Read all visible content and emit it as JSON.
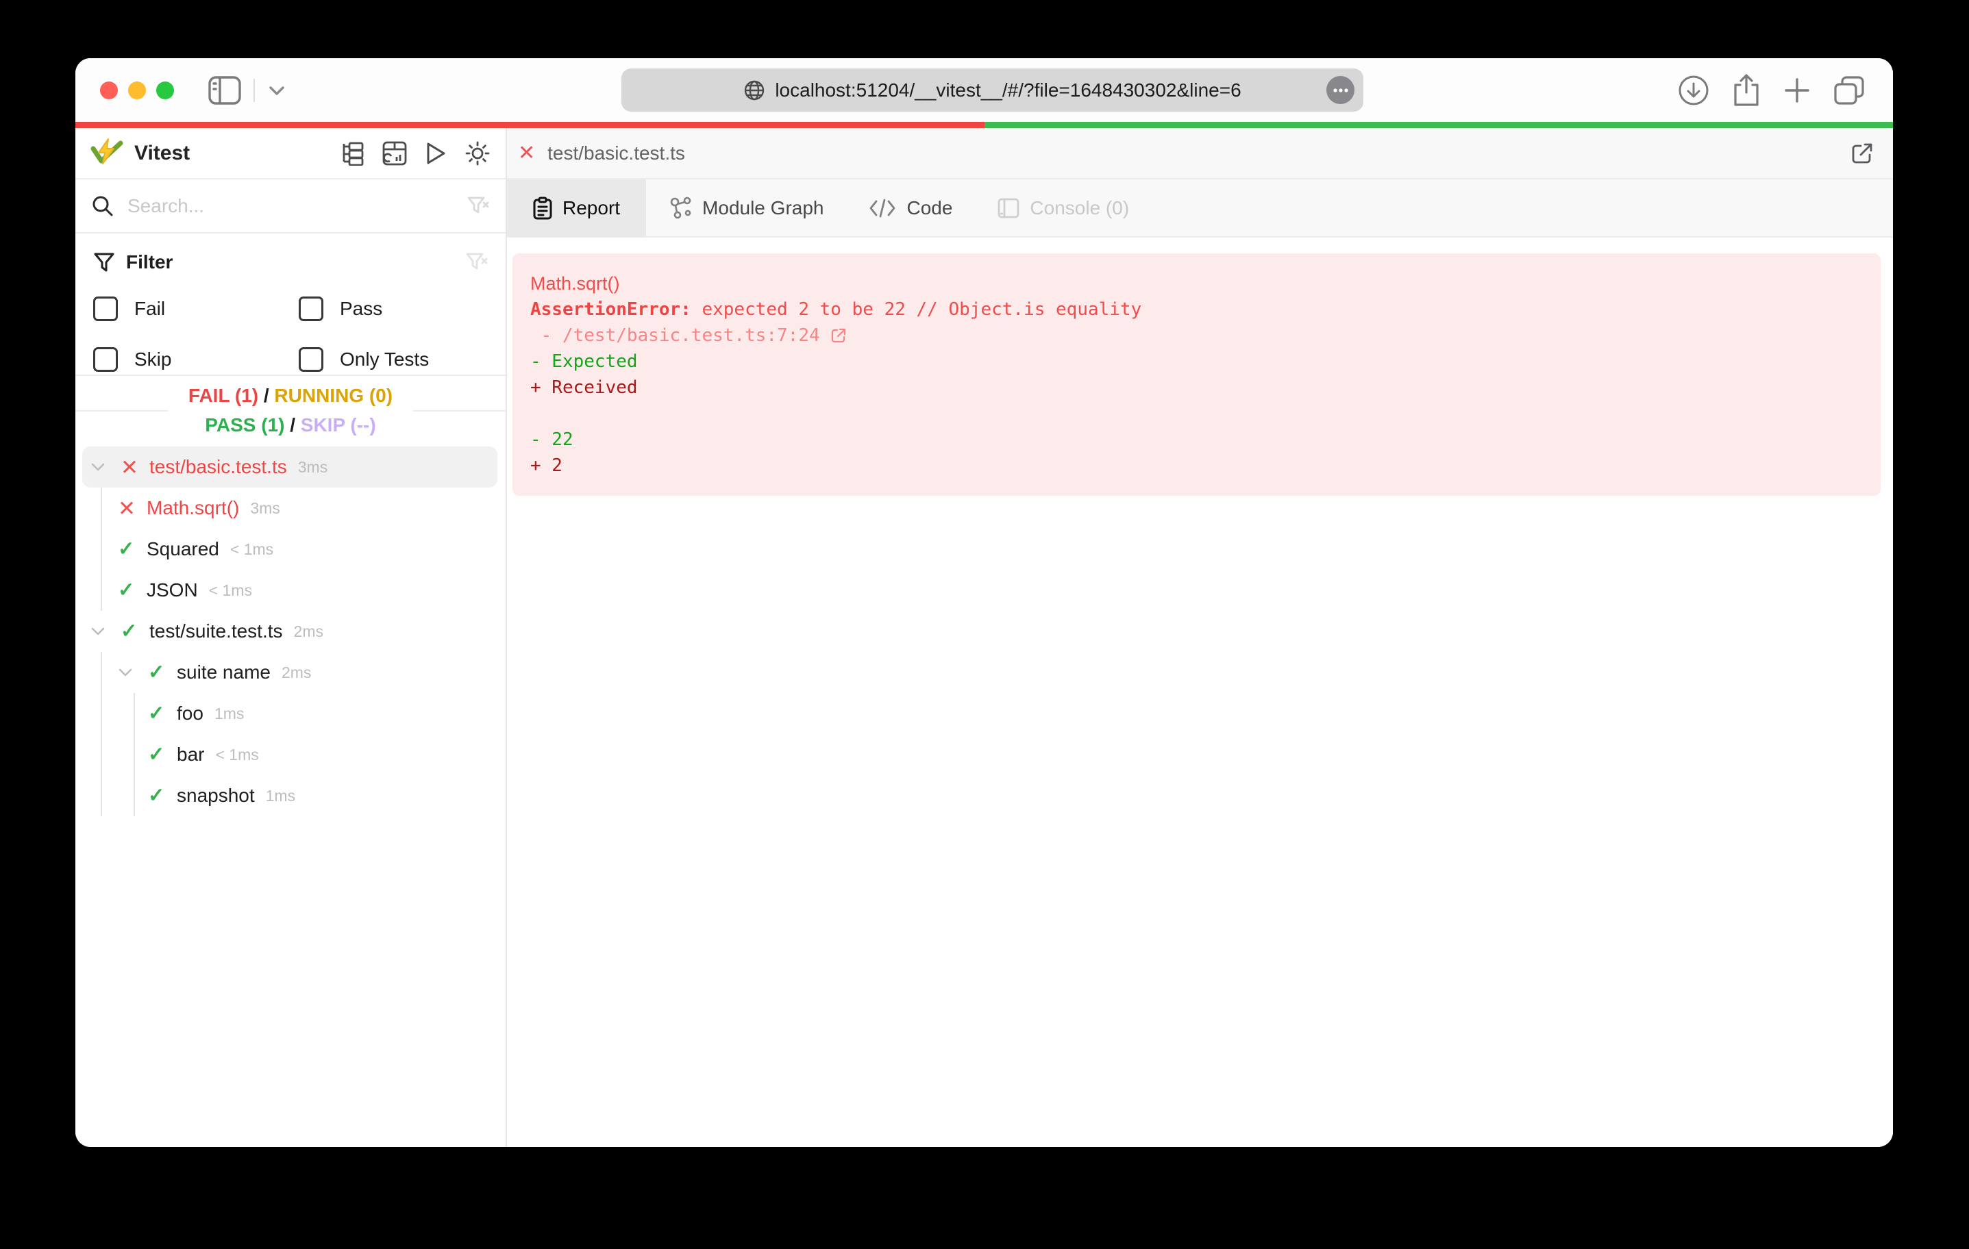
{
  "browser": {
    "url": "localhost:51204/__vitest__/#/?file=1648430302&line=6"
  },
  "progress": {
    "fail_percent": 50,
    "pass_percent": 50
  },
  "sidebar": {
    "title": "Vitest",
    "search_placeholder": "Search...",
    "filter": {
      "title": "Filter",
      "options": [
        {
          "label": "Fail",
          "checked": false
        },
        {
          "label": "Pass",
          "checked": false
        },
        {
          "label": "Skip",
          "checked": false
        },
        {
          "label": "Only Tests",
          "checked": false
        }
      ]
    },
    "summary": {
      "fail": "FAIL (1)",
      "running": "RUNNING (0)",
      "pass": "PASS (1)",
      "skip": "SKIP (--)",
      "separator": "/"
    },
    "tree": [
      {
        "label": "test/basic.test.ts",
        "duration": "3ms",
        "state": "fail",
        "level": 0,
        "expanded": true,
        "selected": true
      },
      {
        "label": "Math.sqrt()",
        "duration": "3ms",
        "state": "fail",
        "level": 1
      },
      {
        "label": "Squared",
        "duration": "< 1ms",
        "state": "pass",
        "level": 1
      },
      {
        "label": "JSON",
        "duration": "< 1ms",
        "state": "pass",
        "level": 1
      },
      {
        "label": "test/suite.test.ts",
        "duration": "2ms",
        "state": "pass",
        "level": 0,
        "expanded": true
      },
      {
        "label": "suite name",
        "duration": "2ms",
        "state": "pass",
        "level": 1,
        "expanded": true
      },
      {
        "label": "foo",
        "duration": "1ms",
        "state": "pass",
        "level": 2
      },
      {
        "label": "bar",
        "duration": "< 1ms",
        "state": "pass",
        "level": 2
      },
      {
        "label": "snapshot",
        "duration": "1ms",
        "state": "pass",
        "level": 2
      }
    ]
  },
  "main": {
    "file_tab": "test/basic.test.ts",
    "close_glyph": "✕",
    "tabs": [
      {
        "label": "Report",
        "active": true
      },
      {
        "label": "Module Graph",
        "active": false
      },
      {
        "label": "Code",
        "active": false
      },
      {
        "label": "Console (0)",
        "active": false,
        "disabled": true
      }
    ],
    "error": {
      "test_name": "Math.sqrt()",
      "error_name": "AssertionError:",
      "error_message": " expected 2 to be 22 // Object.is equality",
      "location": " - /test/basic.test.ts:7:24 ",
      "diff_expected_label": "- Expected",
      "diff_received_label": "+ Received",
      "diff_expected_value": "- 22",
      "diff_received_value": "+ 2"
    }
  },
  "colors": {
    "fail": "#ef4444",
    "pass": "#2db14e",
    "running": "#d9a406",
    "skip": "#c8aef8",
    "progress_fail": "#f04545",
    "progress_pass": "#3fba50",
    "error_panel_bg": "#fcebea",
    "diff_expected": "#15a31c",
    "diff_received": "#a81a1a",
    "selected_row_bg": "#f1f1f2",
    "active_tab_bg": "#e9e9ea"
  }
}
